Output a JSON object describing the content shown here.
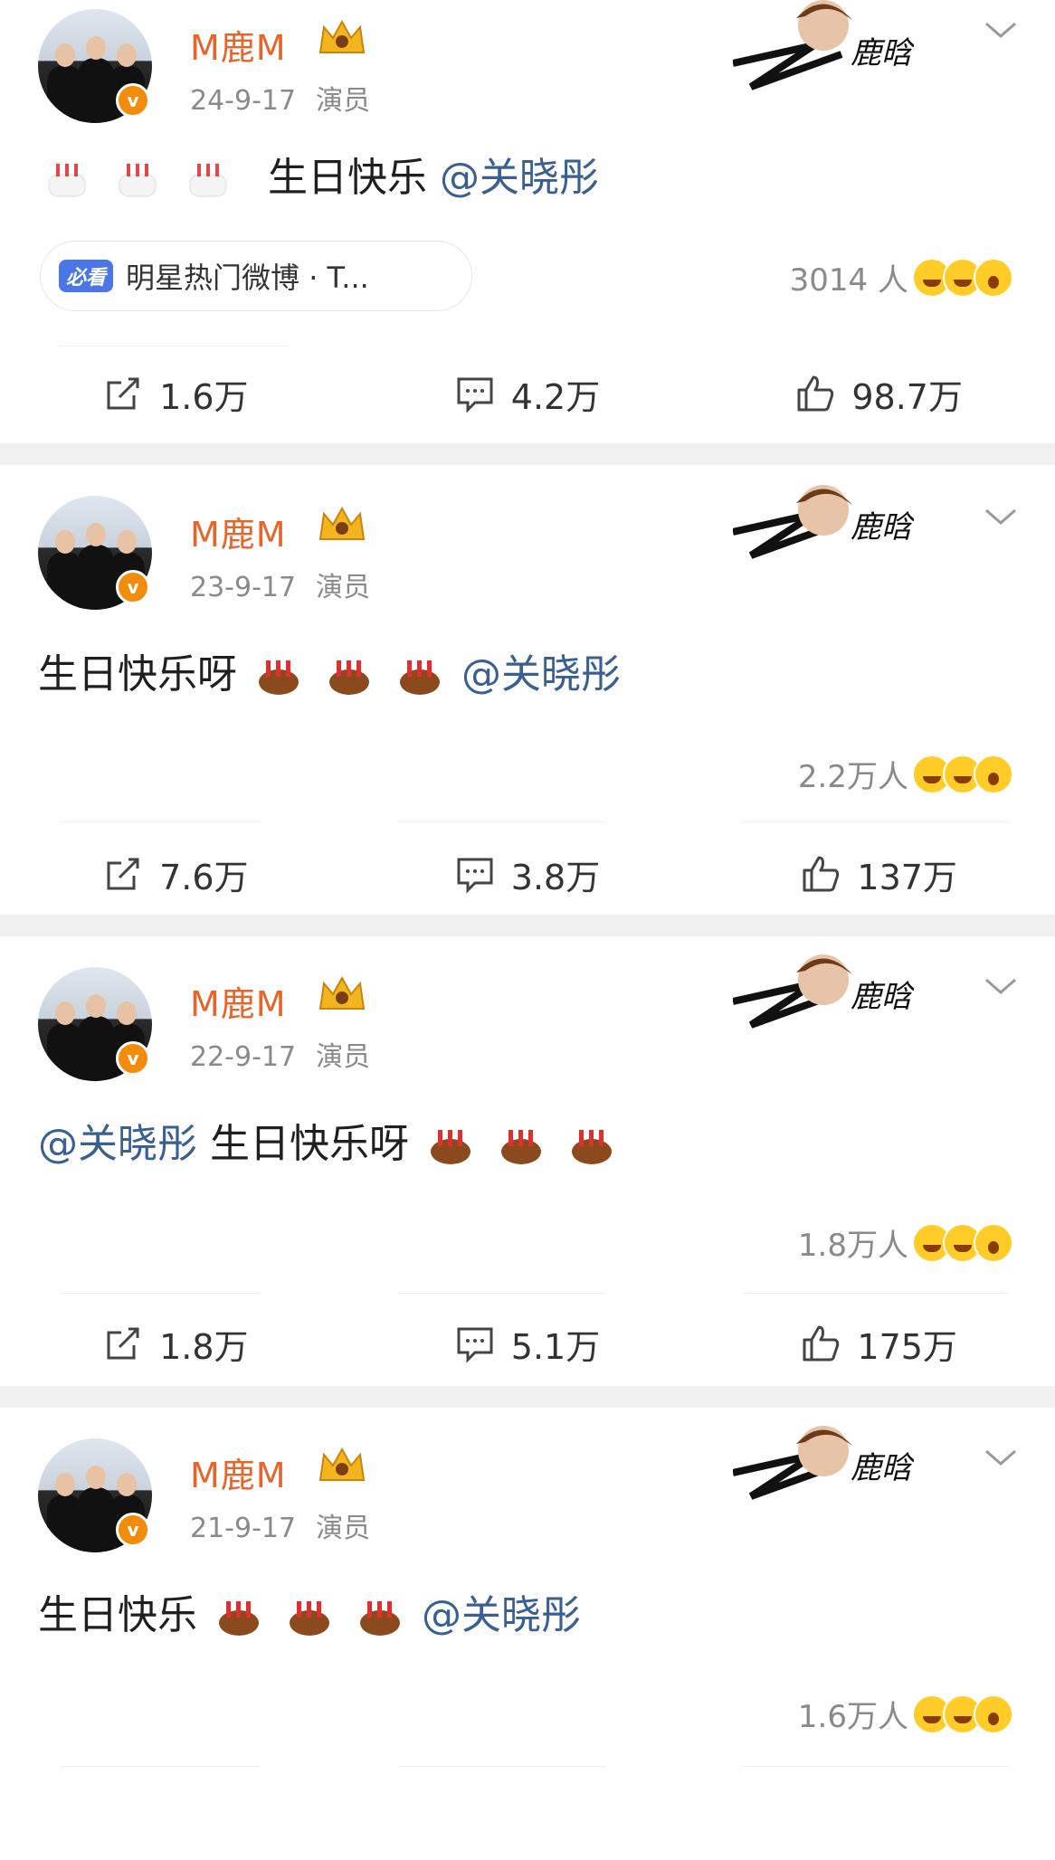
{
  "posts": [
    {
      "username": "M鹿M",
      "date": "24-9-17",
      "role": "演员",
      "text_before": "",
      "cakes_before": 3,
      "text_after": "生日快乐",
      "mention": "@关晓彤",
      "cakes_after": 0,
      "tail_text": "",
      "hot_tag": "必看",
      "hot_text": "明星热门微博 · T...",
      "reaction_count": "3014 人",
      "repost": "1.6万",
      "comment": "4.2万",
      "like": "98.7万"
    },
    {
      "username": "M鹿M",
      "date": "23-9-17",
      "role": "演员",
      "text_before": "生日快乐呀",
      "cakes_before": 3,
      "text_after": "",
      "mention": "@关晓彤",
      "cakes_after": 0,
      "tail_text": "",
      "reaction_count": "2.2万人",
      "repost": "7.6万",
      "comment": "3.8万",
      "like": "137万"
    },
    {
      "username": "M鹿M",
      "date": "22-9-17",
      "role": "演员",
      "mention_first": "@关晓彤",
      "text_after": " 生日快乐呀",
      "cakes_after": 3,
      "reaction_count": "1.8万人",
      "repost": "1.8万",
      "comment": "5.1万",
      "like": "175万"
    },
    {
      "username": "M鹿M",
      "date": "21-9-17",
      "role": "演员",
      "text_before": "生日快乐 ",
      "cakes_before": 3,
      "mention": "@关晓彤",
      "reaction_count": "1.6万人"
    }
  ],
  "icons": {
    "verified": "verified-v-badge",
    "crown": "crown-icon",
    "more": "chevron-down-icon",
    "repost": "repost-icon",
    "comment": "comment-icon",
    "like": "thumbs-up-icon",
    "cake": "birthday-cake-icon"
  },
  "colors": {
    "username": "#e8652a",
    "mention": "#3a5f91",
    "verified": "#f28c0a",
    "hot_tag": "#4a76e8",
    "separator": "#f0f0f0"
  }
}
